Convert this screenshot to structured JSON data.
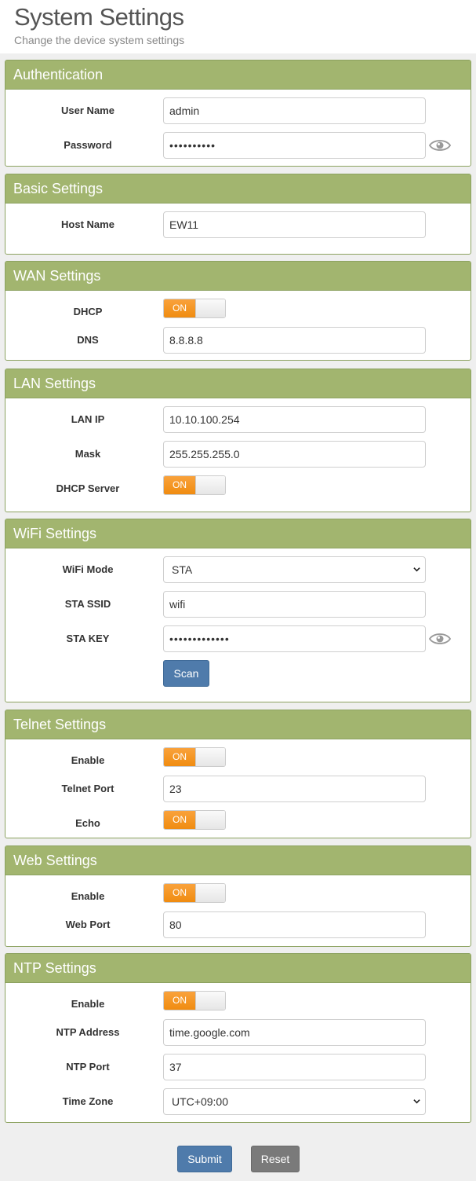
{
  "header": {
    "title": "System Settings",
    "subtitle": "Change the device system settings"
  },
  "authentication": {
    "title": "Authentication",
    "username_label": "User Name",
    "username_value": "admin",
    "password_label": "Password",
    "password_value": "••••••••••"
  },
  "basic": {
    "title": "Basic Settings",
    "hostname_label": "Host Name",
    "hostname_value": "EW11"
  },
  "wan": {
    "title": "WAN Settings",
    "dhcp_label": "DHCP",
    "dhcp_state": "ON",
    "dns_label": "DNS",
    "dns_value": "8.8.8.8"
  },
  "lan": {
    "title": "LAN Settings",
    "ip_label": "LAN IP",
    "ip_value": "10.10.100.254",
    "mask_label": "Mask",
    "mask_value": "255.255.255.0",
    "dhcp_server_label": "DHCP Server",
    "dhcp_server_state": "ON"
  },
  "wifi": {
    "title": "WiFi Settings",
    "mode_label": "WiFi Mode",
    "mode_value": "STA",
    "ssid_label": "STA SSID",
    "ssid_value": "wifi",
    "key_label": "STA KEY",
    "key_value": "•••••••••••••",
    "scan_label": "Scan"
  },
  "telnet": {
    "title": "Telnet Settings",
    "enable_label": "Enable",
    "enable_state": "ON",
    "port_label": "Telnet Port",
    "port_value": "23",
    "echo_label": "Echo",
    "echo_state": "ON"
  },
  "web": {
    "title": "Web Settings",
    "enable_label": "Enable",
    "enable_state": "ON",
    "port_label": "Web Port",
    "port_value": "80"
  },
  "ntp": {
    "title": "NTP Settings",
    "enable_label": "Enable",
    "enable_state": "ON",
    "address_label": "NTP Address",
    "address_value": "time.google.com",
    "port_label": "NTP Port",
    "port_value": "37",
    "timezone_label": "Time Zone",
    "timezone_value": "UTC+09:00"
  },
  "actions": {
    "submit_label": "Submit",
    "reset_label": "Reset"
  },
  "colors": {
    "panel_header": "#a2b56f",
    "toggle_on": "#f7941d",
    "primary_button": "#4f7bab",
    "secondary_button": "#7a7a7a"
  }
}
